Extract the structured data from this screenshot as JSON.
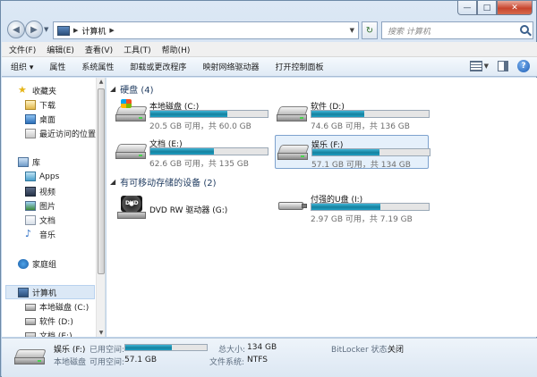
{
  "window": {
    "caption": {
      "minimize": "—",
      "maximize": "□",
      "close": "✕"
    }
  },
  "nav": {
    "back_glyph": "◀",
    "forward_glyph": "▶",
    "address": {
      "crumb": "计算机"
    },
    "refresh_glyph": "↻",
    "search": {
      "placeholder": "搜索 计算机"
    }
  },
  "menubar": [
    "文件(F)",
    "编辑(E)",
    "查看(V)",
    "工具(T)",
    "帮助(H)"
  ],
  "toolbar": {
    "items": [
      "组织 ▾",
      "属性",
      "系统属性",
      "卸载或更改程序",
      "映射网络驱动器",
      "打开控制面板"
    ],
    "help": "?"
  },
  "sidebar": {
    "favorites": {
      "label": "收藏夹",
      "items": [
        "下载",
        "桌面",
        "最近访问的位置"
      ]
    },
    "libraries": {
      "label": "库",
      "items": [
        "Apps",
        "视频",
        "图片",
        "文档",
        "音乐"
      ]
    },
    "homegroup": {
      "label": "家庭组"
    },
    "computer": {
      "label": "计算机",
      "items": [
        "本地磁盘 (C:)",
        "软件 (D:)",
        "文档 (E:)"
      ]
    }
  },
  "content": {
    "hard_drives": {
      "label": "硬盘 (4)",
      "drives": [
        {
          "name": "本地磁盘 (C:)",
          "info": "20.5 GB 可用，共 60.0 GB",
          "used": 0.66,
          "icon": "windows-drive-icon"
        },
        {
          "name": "软件 (D:)",
          "info": "74.6 GB 可用，共 136 GB",
          "used": 0.45,
          "icon": "hard-drive-icon"
        },
        {
          "name": "文档 (E:)",
          "info": "62.6 GB 可用，共 135 GB",
          "used": 0.54,
          "icon": "hard-drive-icon"
        },
        {
          "name": "娱乐 (F:)",
          "info": "57.1 GB 可用，共 134 GB",
          "used": 0.57,
          "icon": "hard-drive-icon",
          "selected": true
        }
      ]
    },
    "removable": {
      "label": "有可移动存储的设备 (2)",
      "devices": [
        {
          "name": "DVD RW 驱动器 (G:)",
          "icon": "dvd-drive-icon"
        },
        {
          "name": "付强的U盘 (I:)",
          "info": "2.97 GB 可用，共 7.19 GB",
          "used": 0.59,
          "icon": "usb-drive-icon"
        }
      ]
    }
  },
  "status": {
    "name": "娱乐 (F:)",
    "used_label": "已用空间:",
    "used_fraction": 0.57,
    "type": "本地磁盘",
    "free_label": "可用空间:",
    "free_value": "57.1 GB",
    "total_label": "总大小:",
    "total_value": "134 GB",
    "fs_label": "文件系统:",
    "fs_value": "NTFS",
    "bitlocker_label": "BitLocker 状态:",
    "bitlocker_value": "关闭"
  },
  "colors": {
    "accent": "#1e9fc4",
    "selection": "#e5f0fb",
    "section_title": "#1e3a5f"
  }
}
